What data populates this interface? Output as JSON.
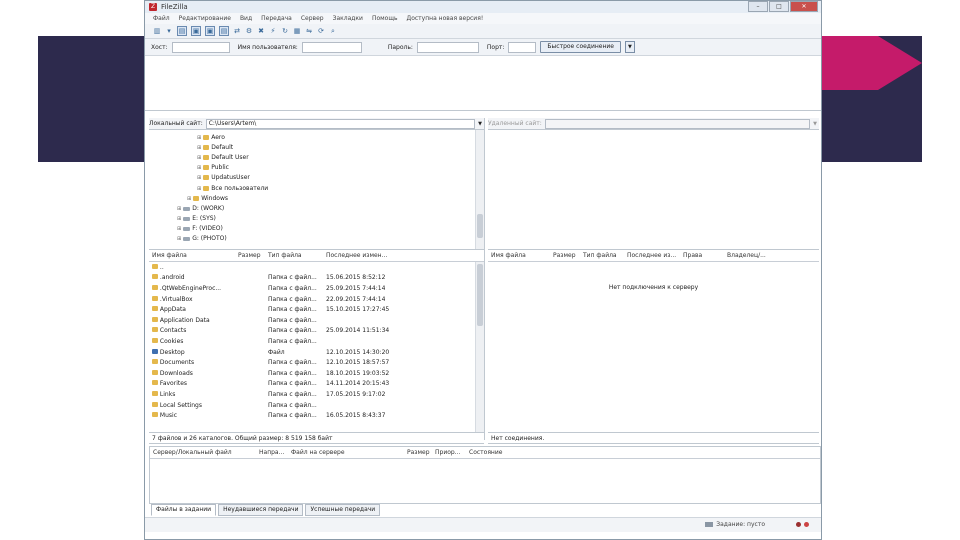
{
  "window": {
    "title": "FileZilla",
    "buttons": {
      "minimize": "–",
      "maximize": "□",
      "close": "✕"
    }
  },
  "menu": [
    "Файл",
    "Редактирование",
    "Вид",
    "Передача",
    "Сервер",
    "Закладки",
    "Помощь",
    "Доступна новая версия!"
  ],
  "quickconnect": {
    "host_label": "Хост:",
    "user_label": "Имя пользователя:",
    "pass_label": "Пароль:",
    "port_label": "Порт:",
    "button_label": "Быстрое соединение",
    "dropdown": "▼"
  },
  "local": {
    "site_label": "Локальный сайт:",
    "path": "C:\\Users\\Artem\\",
    "tree": [
      {
        "label": "Aero",
        "kind": "folder"
      },
      {
        "label": "Default",
        "kind": "folder"
      },
      {
        "label": "Default User",
        "kind": "folder"
      },
      {
        "label": "Public",
        "kind": "folder"
      },
      {
        "label": "UpdatusUser",
        "kind": "folder"
      },
      {
        "label": "Все пользователи",
        "kind": "folder"
      },
      {
        "label": "Windows",
        "kind": "folder"
      },
      {
        "label": "D: (WORK)",
        "kind": "drive"
      },
      {
        "label": "E: (SYS)",
        "kind": "drive"
      },
      {
        "label": "F: (VIDEO)",
        "kind": "drive"
      },
      {
        "label": "G: (PHOTO)",
        "kind": "drive"
      }
    ],
    "columns": [
      "Имя файла",
      "Размер",
      "Тип файла",
      "Последнее измен..."
    ],
    "files": [
      {
        "name": "..",
        "type": "",
        "modified": ""
      },
      {
        "name": ".android",
        "type": "Папка с файл...",
        "modified": "15.06.2015 8:52:12"
      },
      {
        "name": ".QtWebEngineProc...",
        "type": "Папка с файл...",
        "modified": "25.09.2015 7:44:14"
      },
      {
        "name": ".VirtualBox",
        "type": "Папка с файл...",
        "modified": "22.09.2015 7:44:14"
      },
      {
        "name": "AppData",
        "type": "Папка с файл...",
        "modified": "15.10.2015 17:27:45"
      },
      {
        "name": "Application Data",
        "type": "Папка с файл...",
        "modified": ""
      },
      {
        "name": "Contacts",
        "type": "Папка с файл...",
        "modified": "25.09.2014 11:51:34"
      },
      {
        "name": "Cookies",
        "type": "Папка с файл...",
        "modified": ""
      },
      {
        "name": "Desktop",
        "type": "Файл",
        "modified": "12.10.2015 14:30:20"
      },
      {
        "name": "Documents",
        "type": "Папка с файл...",
        "modified": "12.10.2015 18:57:57"
      },
      {
        "name": "Downloads",
        "type": "Папка с файл...",
        "modified": "18.10.2015 19:03:52"
      },
      {
        "name": "Favorites",
        "type": "Папка с файл...",
        "modified": "14.11.2014 20:15:43"
      },
      {
        "name": "Links",
        "type": "Папка с файл...",
        "modified": "17.05.2015 9:17:02"
      },
      {
        "name": "Local Settings",
        "type": "Папка с файл...",
        "modified": ""
      },
      {
        "name": "Music",
        "type": "Папка с файл...",
        "modified": "16.05.2015 8:43:37"
      }
    ],
    "status": "7 файлов и 26 каталогов. Общий размер: 8 519 158 байт"
  },
  "remote": {
    "site_label": "Удаленный сайт:",
    "columns": [
      "Имя файла",
      "Размер",
      "Тип файла",
      "Последнее из...",
      "Права",
      "Владелец/..."
    ],
    "empty_message": "Нет подключения к серверу",
    "status": "Нет соединения."
  },
  "queue": {
    "columns": [
      "Сервер/Локальный файл",
      "Напра...",
      "Файл на сервере",
      "Размер",
      "Приор...",
      "Состояние"
    ],
    "tabs": [
      "Файлы в задании",
      "Неудавшиеся передачи",
      "Успешные передачи"
    ],
    "status": "Задание: пусто"
  },
  "colors": {
    "accent": "#2d2a4d",
    "brand": "#c51b6a",
    "folder": "#e4b84c"
  }
}
